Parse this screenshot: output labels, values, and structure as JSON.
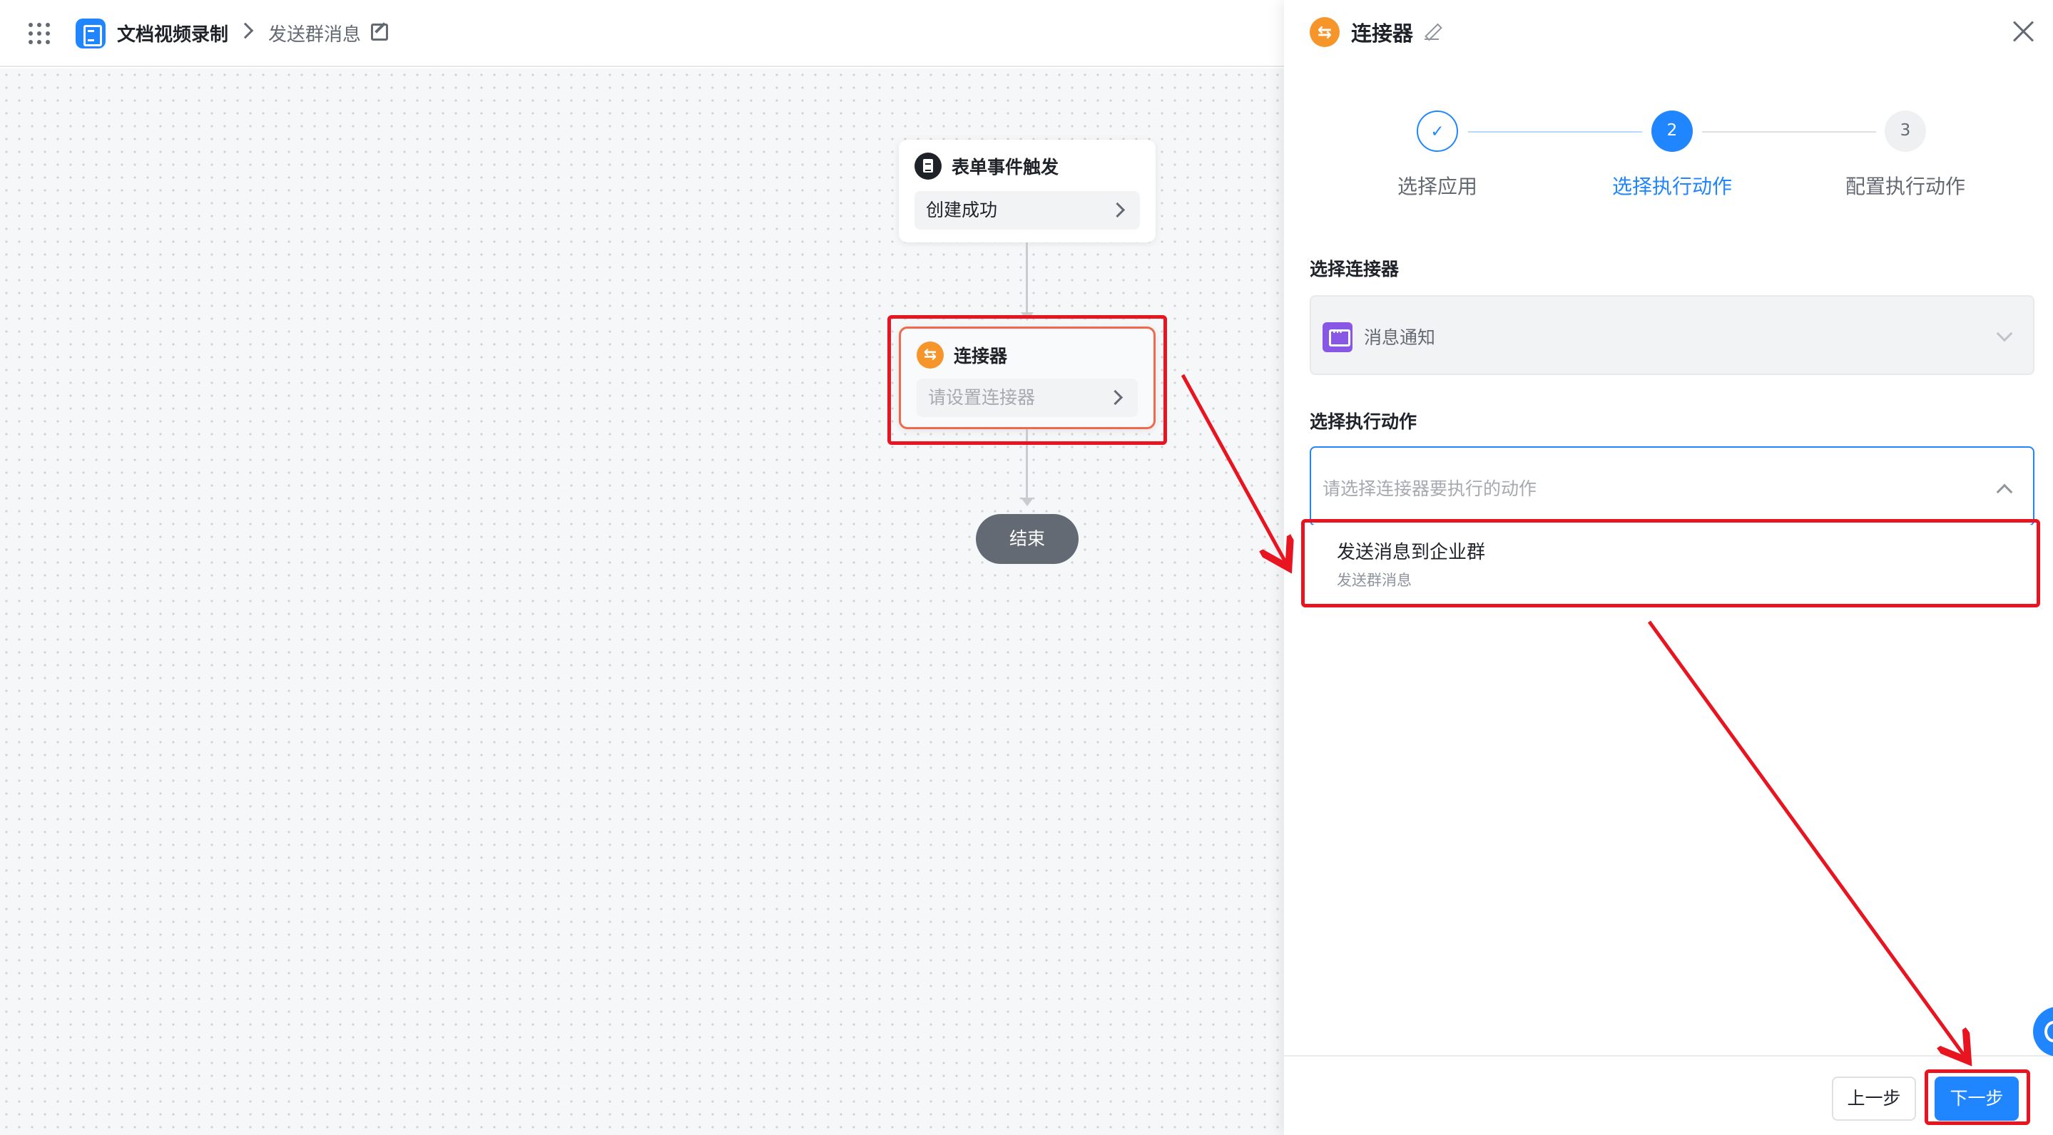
{
  "header": {
    "app_name": "文档视频录制",
    "flow_name": "发送群消息"
  },
  "canvas": {
    "trigger_node": {
      "title": "表单事件触发",
      "value": "创建成功"
    },
    "connector_node": {
      "title": "连接器",
      "placeholder": "请设置连接器"
    },
    "end_node": {
      "label": "结束"
    }
  },
  "panel": {
    "title": "连接器",
    "steps": [
      {
        "number": "1",
        "label": "选择应用",
        "state": "done"
      },
      {
        "number": "2",
        "label": "选择执行动作",
        "state": "active"
      },
      {
        "number": "3",
        "label": "配置执行动作",
        "state": "todo"
      }
    ],
    "connector_field": {
      "label": "选择连接器",
      "value": "消息通知"
    },
    "action_field": {
      "label": "选择执行动作",
      "placeholder": "请选择连接器要执行的动作",
      "options": [
        {
          "title": "发送消息到企业群",
          "subtitle": "发送群消息"
        }
      ]
    },
    "footer": {
      "prev_label": "上一步",
      "next_label": "下一步"
    }
  },
  "colors": {
    "accent": "#1f86ff",
    "highlight": "#e8141f",
    "connector_orange": "#f5952a",
    "message_purple": "#8957e5"
  },
  "icons": {
    "app_grid": "grid-icon",
    "app_logo": "document-icon",
    "connector": "connector-icon",
    "message": "message-icon",
    "close": "close-icon",
    "edit": "edit-icon",
    "step_done": "check-icon"
  }
}
